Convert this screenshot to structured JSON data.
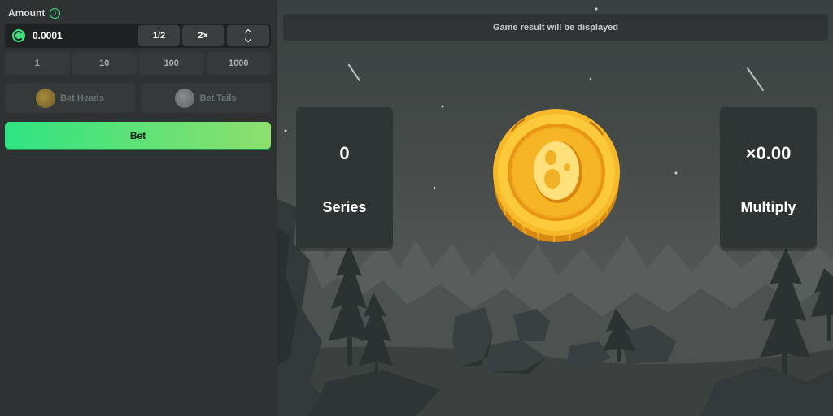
{
  "panel": {
    "amount_label": "Amount",
    "amount_value": "0.0001",
    "half_label": "1/2",
    "double_label": "2×",
    "quick_amounts": [
      "1",
      "10",
      "100",
      "1000"
    ],
    "bet_heads_label": "Bet Heads",
    "bet_tails_label": "Bet Tails",
    "bet_label": "Bet"
  },
  "game": {
    "result_text": "Game result will be displayed",
    "series_value": "0",
    "series_label": "Series",
    "multiply_value": "×0.00",
    "multiply_label": "Multiply"
  },
  "colors": {
    "accent": "#3ee07f",
    "bet_gradient_start": "#2fe382",
    "bet_gradient_end": "#8ee06d",
    "coin_gold": "#f6b92a"
  },
  "icons": {
    "info": "info-icon",
    "currency": "currency-coin-icon",
    "updown": "chevron-updown-icon"
  }
}
